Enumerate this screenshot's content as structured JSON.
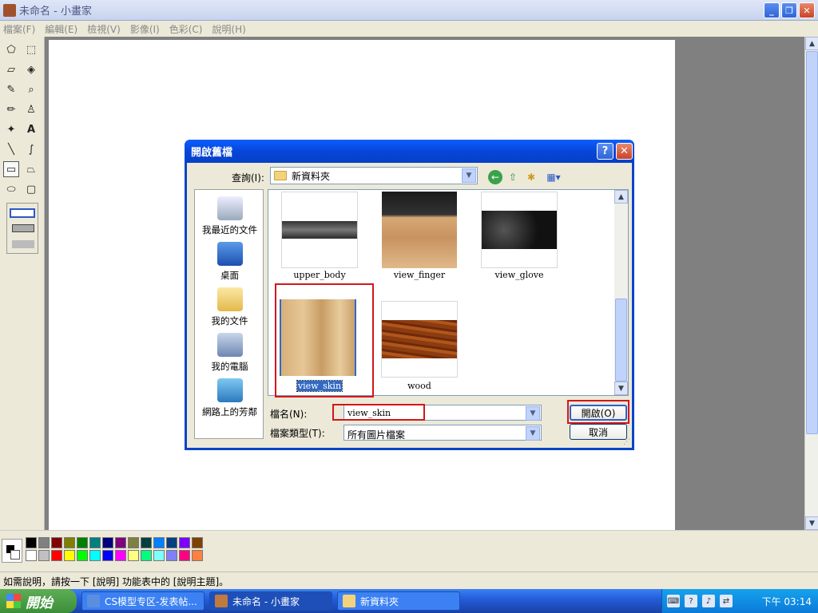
{
  "window": {
    "title": "未命名 - 小畫家",
    "app_icon": "paint-brush-icon"
  },
  "menu": [
    "檔案(F)",
    "編輯(E)",
    "檢視(V)",
    "影像(I)",
    "色彩(C)",
    "說明(H)"
  ],
  "dialog": {
    "title": "開啟舊檔",
    "lookin_label": "查詢(I):",
    "lookin_value": "新資料夾",
    "places": [
      {
        "label": "我最近的文件",
        "icon": "recent-documents-icon"
      },
      {
        "label": "桌面",
        "icon": "desktop-icon"
      },
      {
        "label": "我的文件",
        "icon": "my-documents-icon"
      },
      {
        "label": "我的電腦",
        "icon": "my-computer-icon"
      },
      {
        "label": "網路上的芳鄰",
        "icon": "network-places-icon"
      }
    ],
    "files": [
      {
        "name": "upper_body"
      },
      {
        "name": "view_finger"
      },
      {
        "name": "view_glove"
      },
      {
        "name": "view_skin",
        "selected": true
      },
      {
        "name": "wood"
      }
    ],
    "filename_label": "檔名(N):",
    "filename_value": "view_skin",
    "filetype_label": "檔案類型(T):",
    "filetype_value": "所有圖片檔案",
    "open_button": "開啟(O)",
    "cancel_button": "取消"
  },
  "statusbar": {
    "text": "如需說明，請按一下 [說明] 功能表中的 [說明主題]。"
  },
  "taskbar": {
    "start": "開始",
    "tasks": [
      "CS模型专区-发表帖...",
      "未命名 - 小畫家",
      "新資料夾"
    ],
    "clock": "下午 03:14"
  },
  "colors": {
    "palette_top": [
      "#000000",
      "#808080",
      "#800000",
      "#808000",
      "#008000",
      "#008080",
      "#000080",
      "#800080",
      "#808040",
      "#004040",
      "#0080ff",
      "#004080",
      "#8000ff",
      "#804000"
    ],
    "palette_bottom": [
      "#ffffff",
      "#c0c0c0",
      "#ff0000",
      "#ffff00",
      "#00ff00",
      "#00ffff",
      "#0000ff",
      "#ff00ff",
      "#ffff80",
      "#00ff80",
      "#80ffff",
      "#8080ff",
      "#ff0080",
      "#ff8040"
    ],
    "highlight": "#d2161b"
  }
}
